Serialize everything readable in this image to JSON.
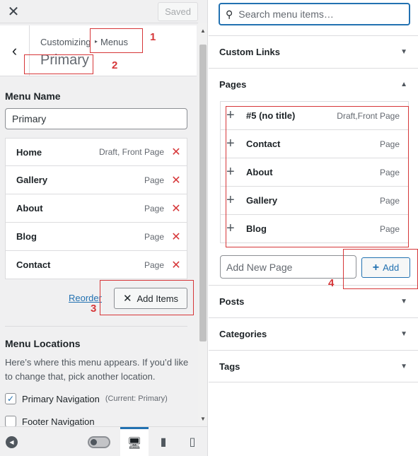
{
  "topbar": {
    "close_label": "✕",
    "saved_label": "Saved"
  },
  "header": {
    "breadcrumb_root": "Customizing",
    "breadcrumb_current": "Menus",
    "title": "Primary"
  },
  "annotations": [
    "1",
    "2",
    "3",
    "4"
  ],
  "menu_name": {
    "label": "Menu Name",
    "value": "Primary"
  },
  "menu_items": [
    {
      "title": "Home",
      "type": "Draft, Front Page"
    },
    {
      "title": "Gallery",
      "type": "Page"
    },
    {
      "title": "About",
      "type": "Page"
    },
    {
      "title": "Blog",
      "type": "Page"
    },
    {
      "title": "Contact",
      "type": "Page"
    }
  ],
  "actions": {
    "reorder_label": "Reorder",
    "add_items_label": "Add Items"
  },
  "locations": {
    "title": "Menu Locations",
    "description": "Here’s where this menu appears. If you’d like to change that, pick another location.",
    "items": [
      {
        "label": "Primary Navigation",
        "current": "(Current: Primary)",
        "checked": true
      },
      {
        "label": "Footer Navigation",
        "current": "",
        "checked": false
      }
    ]
  },
  "right": {
    "search_placeholder": "Search menu items…",
    "sections": {
      "custom_links": "Custom Links",
      "pages": "Pages",
      "posts": "Posts",
      "categories": "Categories",
      "tags": "Tags"
    },
    "pages": [
      {
        "title": "#5 (no title)",
        "type": "Draft,Front Page"
      },
      {
        "title": "Contact",
        "type": "Page"
      },
      {
        "title": "About",
        "type": "Page"
      },
      {
        "title": "Gallery",
        "type": "Page"
      },
      {
        "title": "Blog",
        "type": "Page"
      }
    ],
    "new_page_placeholder": "Add New Page",
    "add_label": "Add"
  },
  "colors": {
    "accent": "#2271b1",
    "annotation": "#d63638",
    "delete": "#d63638"
  }
}
